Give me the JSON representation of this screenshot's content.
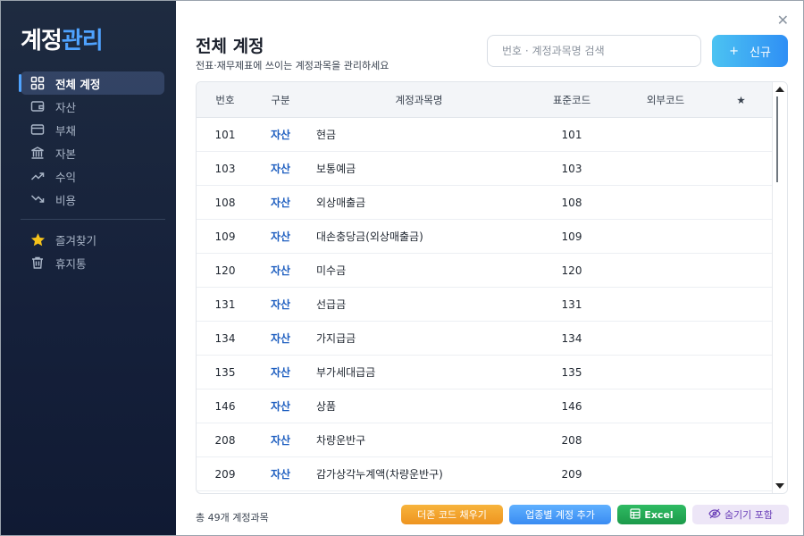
{
  "app": {
    "logo_part1": "계정",
    "logo_part2": "관리"
  },
  "sidebar": {
    "items": [
      {
        "label": "전체 계정",
        "icon": "grid-icon",
        "active": true
      },
      {
        "label": "자산",
        "icon": "wallet-icon"
      },
      {
        "label": "부채",
        "icon": "card-icon"
      },
      {
        "label": "자본",
        "icon": "bank-icon"
      },
      {
        "label": "수익",
        "icon": "trend-up-icon"
      },
      {
        "label": "비용",
        "icon": "trend-down-icon"
      }
    ],
    "extra": [
      {
        "label": "즐겨찾기",
        "icon": "star-icon"
      },
      {
        "label": "휴지통",
        "icon": "trash-icon"
      }
    ]
  },
  "header": {
    "title": "전체 계정",
    "subtitle": "전표·재무제표에 쓰이는 계정과목을 관리하세요",
    "search_placeholder": "번호 · 계정과목명 검색",
    "new_button": "신규",
    "new_button_icon": "+"
  },
  "table": {
    "columns": {
      "num": "번호",
      "type": "구분",
      "name": "계정과목명",
      "std": "표준코드",
      "ext": "외부코드",
      "fav": "★"
    },
    "rows": [
      {
        "num": "101",
        "type": "자산",
        "name": "현금",
        "std": "101",
        "ext": ""
      },
      {
        "num": "103",
        "type": "자산",
        "name": "보통예금",
        "std": "103",
        "ext": ""
      },
      {
        "num": "108",
        "type": "자산",
        "name": "외상매출금",
        "std": "108",
        "ext": ""
      },
      {
        "num": "109",
        "type": "자산",
        "name": "대손충당금(외상매출금)",
        "std": "109",
        "ext": ""
      },
      {
        "num": "120",
        "type": "자산",
        "name": "미수금",
        "std": "120",
        "ext": ""
      },
      {
        "num": "131",
        "type": "자산",
        "name": "선급금",
        "std": "131",
        "ext": ""
      },
      {
        "num": "134",
        "type": "자산",
        "name": "가지급금",
        "std": "134",
        "ext": ""
      },
      {
        "num": "135",
        "type": "자산",
        "name": "부가세대급금",
        "std": "135",
        "ext": ""
      },
      {
        "num": "146",
        "type": "자산",
        "name": "상품",
        "std": "146",
        "ext": ""
      },
      {
        "num": "208",
        "type": "자산",
        "name": "차량운반구",
        "std": "208",
        "ext": ""
      },
      {
        "num": "209",
        "type": "자산",
        "name": "감가상각누계액(차량운반구)",
        "std": "209",
        "ext": ""
      }
    ]
  },
  "footer": {
    "total": "총 49개 계정과목",
    "fill_button": "더존 코드 채우기",
    "add_button": "업종별 계정 추가",
    "excel_button": "Excel",
    "hide_button": "숨기기 포함"
  },
  "colors": {
    "accent": "#4fa3ff",
    "type_text": "#1f5fc0",
    "sidebar_bg": "#1a2540"
  }
}
